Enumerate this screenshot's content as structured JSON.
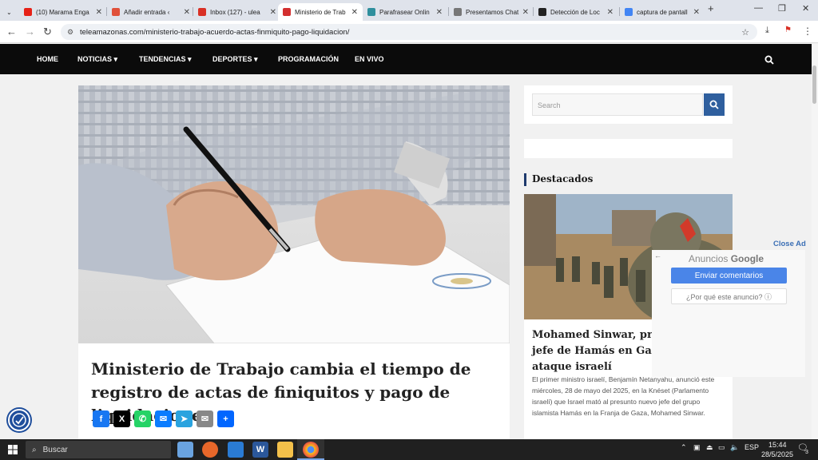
{
  "browser": {
    "tabs": [
      {
        "label": "(10) Marama Enga",
        "color": "#e62117"
      },
      {
        "label": "Añadir entrada ‹",
        "color": "#e0503a"
      },
      {
        "label": "Inbox (127) - ulea",
        "color": "#d93025"
      },
      {
        "label": "Ministerio de Trab",
        "color": "#d32f2f",
        "active": true
      },
      {
        "label": "Parafrasear Onlin",
        "color": "#2f8f9d"
      },
      {
        "label": "Presentamos Chat",
        "color": "#777777"
      },
      {
        "label": "Detección de Loc",
        "color": "#222222"
      },
      {
        "label": "captura de pantall",
        "color": "#4285f4"
      }
    ],
    "new_tab": "+",
    "url": "teleamazonas.com/ministerio-trabajo-acuerdo-actas-finmiquito-pago-liquidacion/"
  },
  "site_nav": {
    "items": [
      "HOME",
      "NOTICIAS",
      "TENDENCIAS",
      "DEPORTES",
      "PROGRAMACIÓN",
      "EN VIVO"
    ],
    "dropdowns": [
      false,
      true,
      true,
      true,
      false,
      false
    ]
  },
  "article": {
    "headline": "Ministerio de Trabajo cambia el tiempo de registro de actas de finiquitos y pago de liquidaciones"
  },
  "share_icons": [
    {
      "name": "facebook",
      "glyph": "f",
      "color": "#1877f2"
    },
    {
      "name": "x",
      "glyph": "X",
      "color": "#000000"
    },
    {
      "name": "whatsapp",
      "glyph": "✆",
      "color": "#25d366"
    },
    {
      "name": "messenger",
      "glyph": "✉",
      "color": "#0a7cff"
    },
    {
      "name": "telegram",
      "glyph": "➤",
      "color": "#2aa3df"
    },
    {
      "name": "email",
      "glyph": "✉",
      "color": "#888888"
    },
    {
      "name": "share",
      "glyph": "+",
      "color": "#0166ff"
    }
  ],
  "sidebar": {
    "search_placeholder": "Search",
    "section_title": "Destacados",
    "featured_title": "Mohamed Sinwar, presunto nuevo jefe de Hamás en Gaza, muere en ataque israelí",
    "featured_summary": "El primer ministro israelí, Benjamín Netanyahu, anunció este miércoles, 28 de mayo del 2025, en la Knéset (Parlamento israelí) que Israel mató al presunto nuevo jefe del grupo islamista Hamás en la Franja de Gaza, Mohamed Sinwar."
  },
  "ad": {
    "close": "Close Ad",
    "label_prefix": "Anuncios",
    "label_brand": "Google",
    "feedback": "Enviar comentarios",
    "why": "¿Por qué este anuncio? ⓘ"
  },
  "taskbar": {
    "search": "Buscar",
    "lang": "ESP",
    "time": "15:44",
    "date": "28/5/2025",
    "notif": "3"
  }
}
